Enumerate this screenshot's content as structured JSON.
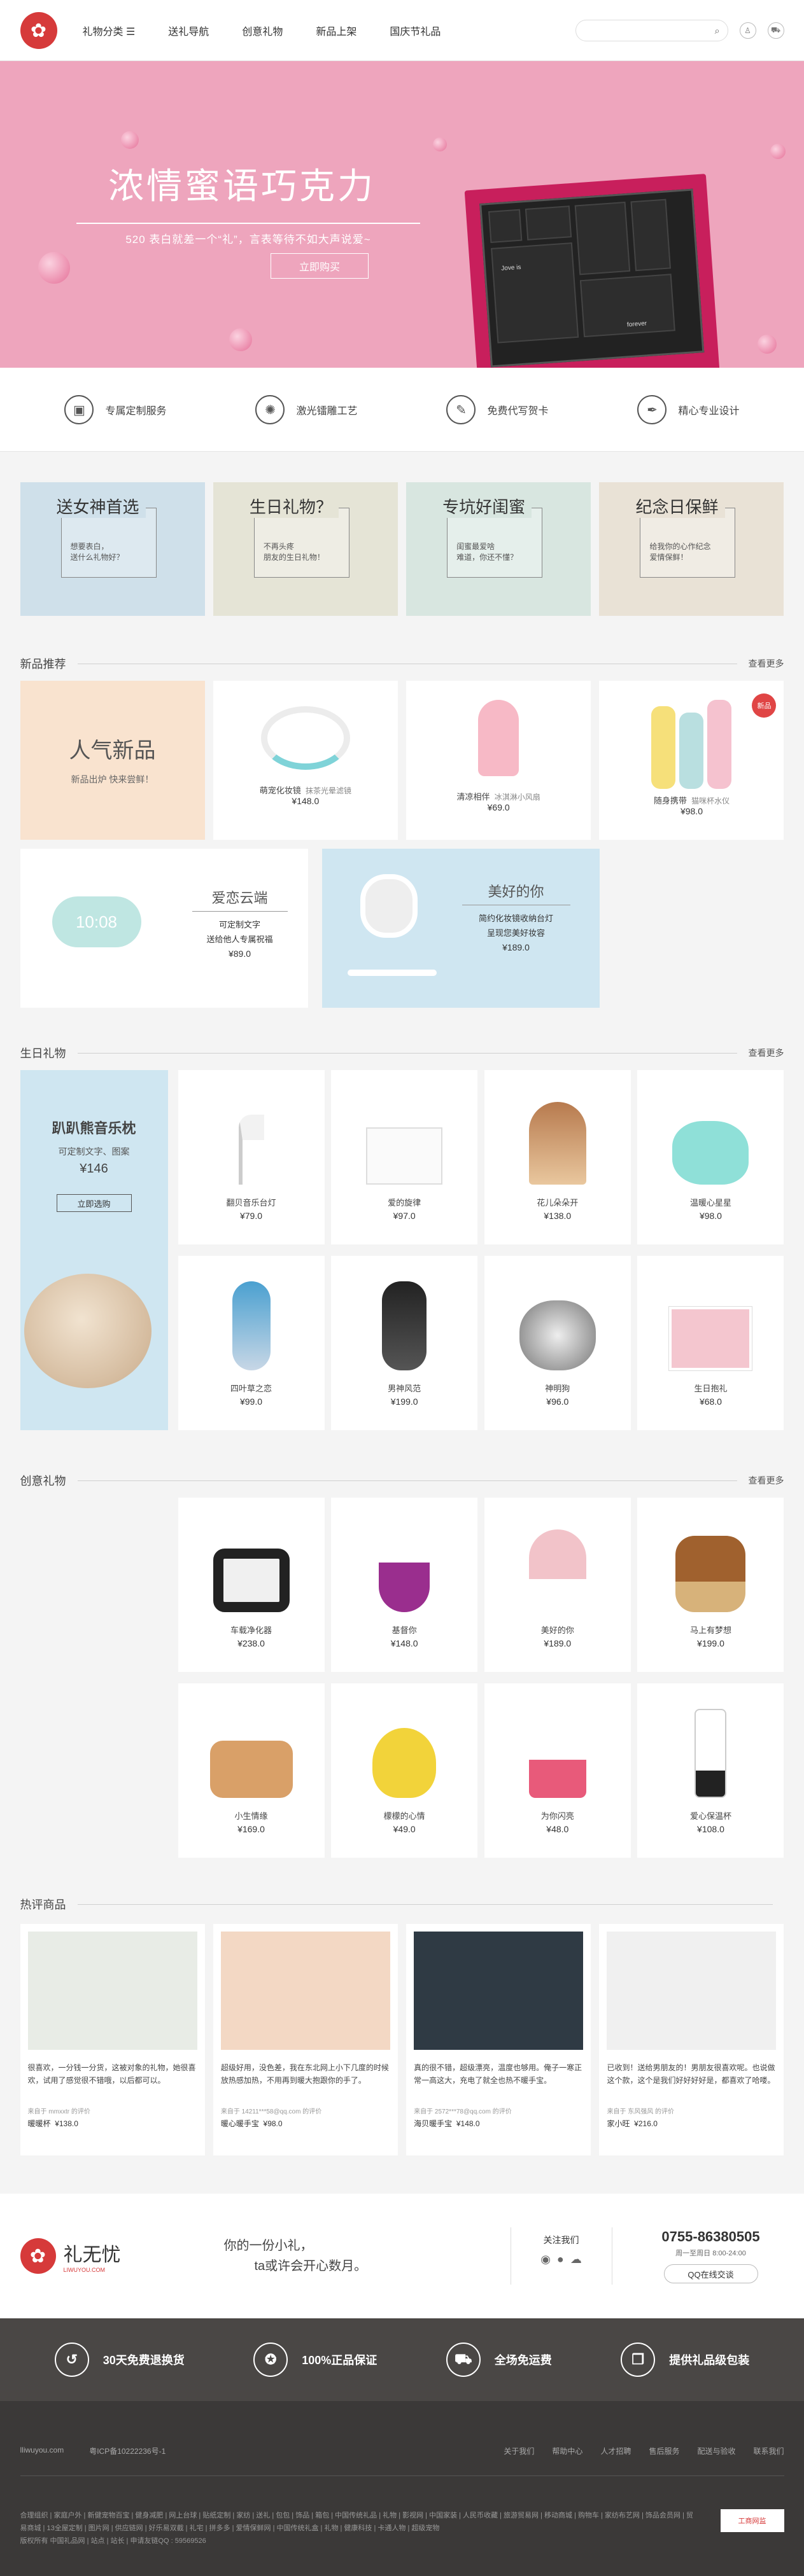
{
  "header": {
    "nav": [
      "礼物分类 ☰",
      "送礼导航",
      "创意礼物",
      "新品上架",
      "国庆节礼品"
    ],
    "search_icon": "search-icon",
    "icons": [
      "user-icon",
      "cart-icon"
    ]
  },
  "banner": {
    "title": "浓情蜜语巧克力",
    "subtitle": "520 表白就差一个“礼”，言表等待不如大声说爱~",
    "button": "立即购买",
    "slides": 5,
    "card_texts": [
      "Jove is",
      "forever"
    ]
  },
  "services": [
    "专属定制服务",
    "激光镭雕工艺",
    "免费代写贺卡",
    "精心专业设计"
  ],
  "categories": [
    {
      "title": "送女神首选",
      "desc": [
        "想要表白，",
        "送什么礼物好？"
      ],
      "bg": "#cfe0ea"
    },
    {
      "title": "生日礼物？",
      "desc": [
        "不再头疼",
        "朋友的生日礼物！"
      ],
      "bg": "#e5e4d6"
    },
    {
      "title": "专坑好闺蜜",
      "desc": [
        "闺蜜最爱啥",
        "难道，你还不懂？"
      ],
      "bg": "#d8e6e0"
    },
    {
      "title": "纪念日保鲜",
      "desc": [
        "给我你的心作纪念",
        "爱情保鲜！"
      ],
      "bg": "#e9e2d6"
    }
  ],
  "new_section": {
    "title": "新品推荐",
    "more": "查看更多",
    "feature": {
      "title": "人气新品",
      "desc": "新品出炉 快来尝鲜！"
    },
    "items": [
      {
        "name": "萌宠化妆镜",
        "sub": "抹茶光晕滤镜",
        "price": "¥148.0"
      },
      {
        "name": "清凉相伴",
        "sub": "冰淇淋小风扇",
        "price": "¥69.0"
      },
      {
        "name": "随身携带",
        "sub": "猫咪杯水仪",
        "price": "¥98.0"
      }
    ],
    "wide": [
      {
        "title": "爱恋云端",
        "lines": [
          "可定制文字",
          "送给他人专属祝福"
        ],
        "price": "¥89.0",
        "clock": "10:08"
      },
      {
        "title": "美好的你",
        "lines": [
          "简约化妆镜收纳台灯",
          "呈现您美好妆容"
        ],
        "price": "¥189.0"
      }
    ],
    "badge": "新品"
  },
  "birthday_section": {
    "title": "生日礼物",
    "more": "查看更多",
    "feature": {
      "title": "趴趴熊音乐枕",
      "lines": [
        "可定制文字、图案"
      ],
      "price": "¥146",
      "button": "立即选购"
    },
    "items": [
      {
        "name": "翻贝音乐台灯",
        "price": "¥79.0"
      },
      {
        "name": "爱的旋律",
        "price": "¥97.0"
      },
      {
        "name": "花儿朵朵开",
        "price": "¥138.0"
      },
      {
        "name": "温暖心星星",
        "price": "¥98.0"
      },
      {
        "name": "四叶草之恋",
        "price": "¥99.0"
      },
      {
        "name": "男神风范",
        "price": "¥199.0"
      },
      {
        "name": "神明狗",
        "price": "¥96.0"
      },
      {
        "name": "生日抱礼",
        "price": "¥68.0"
      }
    ]
  },
  "creative_section": {
    "title": "创意礼物",
    "more": "查看更多",
    "items": [
      {
        "name": "车载净化器",
        "price": "¥238.0"
      },
      {
        "name": "基督你",
        "price": "¥148.0"
      },
      {
        "name": "美好的你",
        "price": "¥189.0"
      },
      {
        "name": "马上有梦想",
        "price": "¥199.0"
      },
      {
        "name": "小生情缘",
        "price": "¥169.0"
      },
      {
        "name": "檬檬的心情",
        "price": "¥49.0"
      },
      {
        "name": "为你闪亮",
        "price": "¥48.0"
      },
      {
        "name": "爱心保温杯",
        "price": "¥108.0"
      }
    ]
  },
  "reviews_section": {
    "title": "热评商品",
    "items": [
      {
        "text": "很喜欢，一分钱一分货，这被对象的礼物，她很喜欢，试用了感觉很不错哦，以后都可以。",
        "user": "来自于 mmxxtr 的评价",
        "product": "暖暖杯",
        "price": "¥138.0"
      },
      {
        "text": "超级好用，没色差，我在东北网上小下几度的时候放热感加热，不用再到暖大抱跟你的手了。",
        "user": "来自于 14211***58@qq.com 的评价",
        "product": "暖心暖手宝",
        "price": "¥98.0"
      },
      {
        "text": "真的很不错，超级漂亮，温度也够用。俺子一寒正常一高这大，充电了就全也热不暖手宝。",
        "user": "来自于 2572***78@qq.com 的评价",
        "product": "海贝暖手宝",
        "price": "¥148.0"
      },
      {
        "text": "已收到！送给男朋友的！男朋友很喜欢呢。也说做这个款，这个是我们好好好好是，都喜欢了哈喽。",
        "user": "来自于 东风强风 的评价",
        "product": "家小旺",
        "price": "¥216.0"
      }
    ]
  },
  "promo": {
    "logo_text": "礼无忧",
    "logo_sub": "LIWUYOU.COM",
    "slogan": [
      "你的一份小礼，",
      "ta或许会开心数月。"
    ],
    "follow": "关注我们",
    "phone": "0755-86380505",
    "hours": "周一至周日 8:00-24:00",
    "qq_btn": "QQ在线交谈"
  },
  "guarantees": [
    "30天免费退换货",
    "100%正品保证",
    "全场免运费",
    "提供礼品级包装"
  ],
  "footer": {
    "site": "lliwuyou.com",
    "icp": "粤ICP备10222236号-1",
    "links": [
      "关于我们",
      "帮助中心",
      "人才招聘",
      "售后服务",
      "配送与验收",
      "联系我们"
    ],
    "tags": "合理组织 | 家庭户外 | 新健宠物百宝 | 健身减肥 | 网上台球 | 贴纸定制 | 家纺 | 送礼 | 包包 | 饰品 | 箱包 | 中国传统礼品 | 礼物 | 影视网 | 中国家装 | 人民币收藏 | 旅游贸易网 | 移动商城 | 购物车 | 家纺布艺网 | 饰品会员网 | 贸易商城 | 13全屋定制 | 图片网 | 供应链网 | 好乐易双截 | 礼宅 | 拼多多 | 爱情保鲜网 | 中国传统礼盒 | 礼物 | 健康科技 | 卡通人物 | 超级宠物",
    "copy": "版权所有 中国礼品网 | 站点 | 站长 | 申请友链QQ : 59569526",
    "badge": "工商网监"
  },
  "colors": {
    "brand": "#d63a3a",
    "banner_bg": "#eea5bd",
    "dark": "#4a4745",
    "light_blue": "#cfe6f1"
  }
}
